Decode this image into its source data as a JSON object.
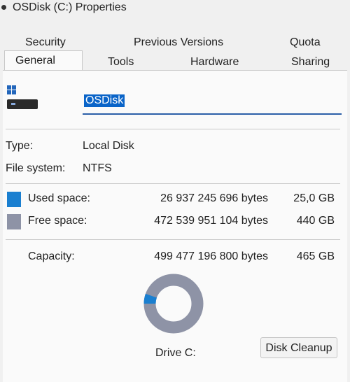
{
  "window": {
    "title": "OSDisk (C:) Properties"
  },
  "tabs": {
    "row1": [
      "Security",
      "Previous Versions",
      "Quota"
    ],
    "row2": [
      "General",
      "Tools",
      "Hardware",
      "Sharing"
    ],
    "active": "General"
  },
  "general": {
    "drive_icon": "hard-drive-icon",
    "volume_name": "OSDisk",
    "type_label": "Type:",
    "type_value": "Local Disk",
    "fs_label": "File system:",
    "fs_value": "NTFS",
    "used": {
      "label": "Used space:",
      "bytes": "26 937 245 696 bytes",
      "size": "25,0 GB",
      "color": "#1a7fd0"
    },
    "free": {
      "label": "Free space:",
      "bytes": "472 539 951 104 bytes",
      "size": "440 GB",
      "color": "#8e93a6"
    },
    "capacity": {
      "label": "Capacity:",
      "bytes": "499 477 196 800 bytes",
      "size": "465 GB"
    },
    "usage_fraction": 0.054,
    "drive_label": "Drive C:",
    "cleanup_button": "Disk Cleanup"
  }
}
